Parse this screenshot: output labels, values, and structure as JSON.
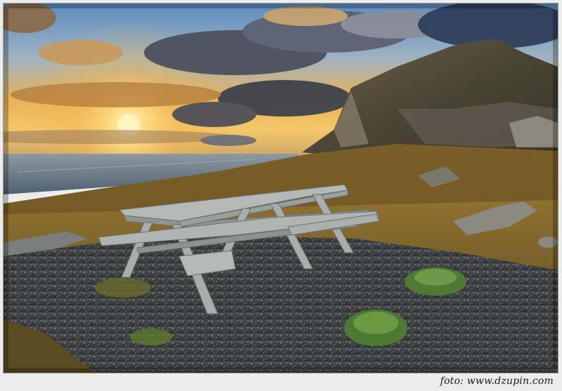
{
  "photo": {
    "subject": "picnic-table-by-the-sea-at-sunset"
  },
  "caption": {
    "text": "foto: www.dzupin.com"
  },
  "colors": {
    "frame": "#ececec",
    "sky_top": "#4d7fb0",
    "sun": "#ffe9a0",
    "sea": "#5c6e7c",
    "grass": "#8a6a2c",
    "gravel": "#3c3e40",
    "table_wood": "#a6aba9"
  }
}
